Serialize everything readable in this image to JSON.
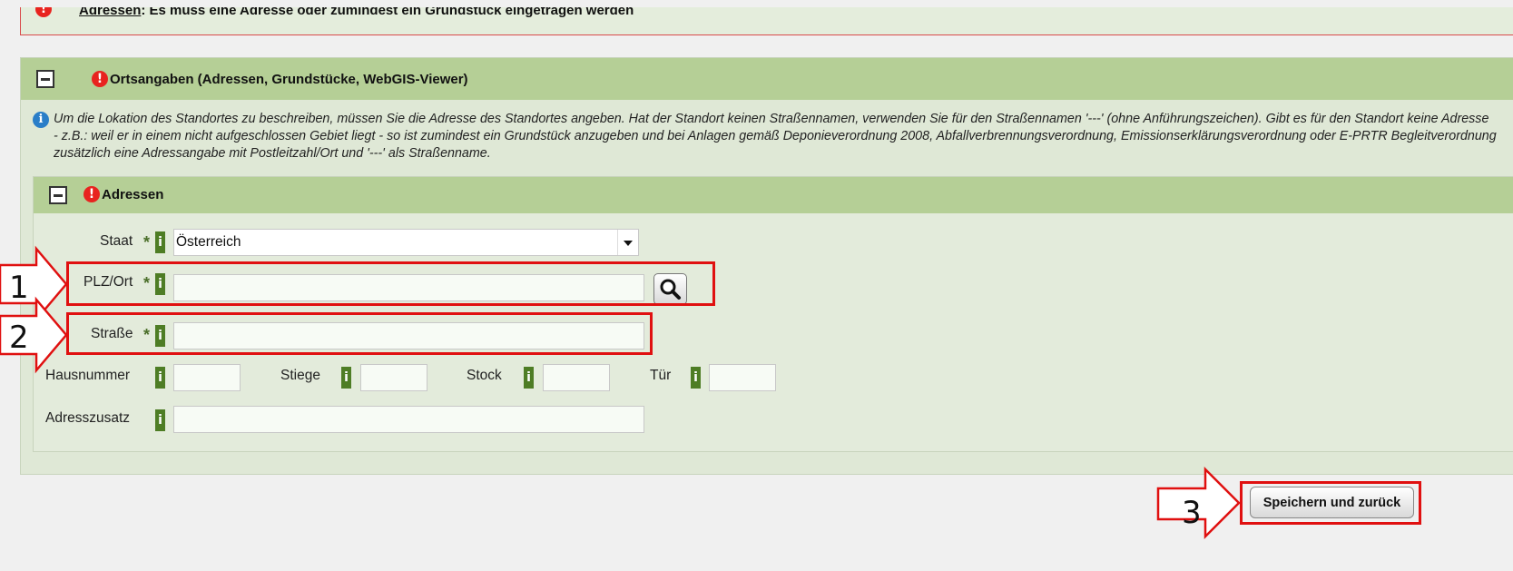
{
  "error": {
    "link_text": "Adressen",
    "message": ": Es muss eine Adresse oder zumindest ein Grundstück eingetragen werden"
  },
  "section": {
    "title": "Ortsangaben (Adressen, Grundstücke, WebGIS-Viewer)",
    "info_text": "Um die Lokation des Standortes zu beschreiben, müssen Sie die Adresse des Standortes angeben. Hat der Standort keinen Straßennamen, verwenden Sie für den Straßennamen '---' (ohne Anführungszeichen). Gibt es für den Standort keine Adresse - z.B.: weil er in einem nicht aufgeschlossen Gebiet liegt - so ist zumindest ein Grundstück anzugeben und bei Anlagen gemäß Deponieverordnung 2008, Abfallverbrennungsverordnung, Emissionserklärungsverordnung oder E-PRTR Begleitverordnung zusätzlich eine Adressangabe mit Postleitzahl/Ort und '---' als Straßenname."
  },
  "addresses": {
    "title": "Adressen",
    "fields": {
      "staat_label": "Staat",
      "staat_value": "Österreich",
      "plz_label": "PLZ/Ort",
      "plz_value": "",
      "strasse_label": "Straße",
      "strasse_value": "",
      "hausnummer_label": "Hausnummer",
      "hausnummer_value": "",
      "stiege_label": "Stiege",
      "stiege_value": "",
      "stock_label": "Stock",
      "stock_value": "",
      "tuer_label": "Tür",
      "tuer_value": "",
      "adresszusatz_label": "Adresszusatz",
      "adresszusatz_value": ""
    },
    "required_mark": "*",
    "info_badge": "i"
  },
  "annotations": {
    "step1": "1",
    "step2": "2",
    "step3": "3",
    "color": "#e01010"
  },
  "buttons": {
    "save_label": "Speichern und zurück"
  },
  "colors": {
    "header_green": "#b5cf96",
    "panel_green": "#dfe8d6",
    "error_red": "#e8231f",
    "info_blue": "#2a7ec8",
    "badge_green": "#4e7d25"
  }
}
